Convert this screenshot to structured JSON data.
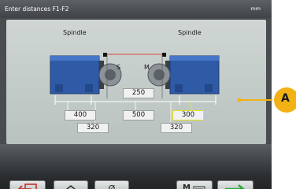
{
  "header": {
    "title": "Enter distances F1-F2",
    "unit": "mm"
  },
  "spindles": {
    "left_label": "Spindle",
    "right_label": "Spindle",
    "marker_s": "S",
    "marker_m": "M"
  },
  "values": {
    "top_center": "250",
    "left_upper": "400",
    "left_lower": "320",
    "center_upper": "500",
    "right_upper": "300",
    "right_lower": "320"
  },
  "toolbar": {
    "back_icon": "exit-arrow-icon",
    "up_icon": "double-chevron-up-icon",
    "diameter_label": "Ø",
    "measure_label": "M",
    "confirm_icon": "green-arrow-right-icon"
  },
  "callout": {
    "letter": "A"
  },
  "colors": {
    "accent": "#f2b215",
    "spindle_blue": "#2f5aa6",
    "active_field": "#e8e020"
  }
}
